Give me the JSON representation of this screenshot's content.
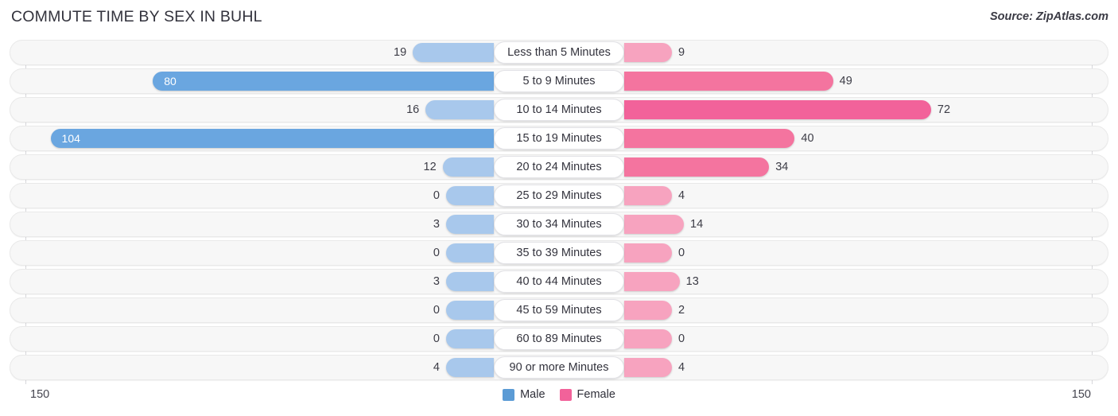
{
  "header": {
    "title": "COMMUTE TIME BY SEX IN BUHL",
    "source": "Source: ZipAtlas.com"
  },
  "axis": {
    "left_max_label": "150",
    "right_max_label": "150",
    "max": 150
  },
  "legend": {
    "items": [
      {
        "label": "Male",
        "color": "#5b9bd5"
      },
      {
        "label": "Female",
        "color": "#f2629a"
      }
    ]
  },
  "colors": {
    "male_light": "#a8c8ec",
    "male_strong": "#6aa6e0",
    "female_light": "#f7a3bf",
    "female_mid": "#f4749f",
    "female_strong": "#f2629a",
    "track": "#f7f7f7"
  },
  "chart_data": {
    "type": "bar",
    "title": "COMMUTE TIME BY SEX IN BUHL",
    "orientation": "horizontal-diverging",
    "xlabel": "",
    "ylabel": "",
    "xlim": [
      -150,
      150
    ],
    "grid": false,
    "legend_position": "bottom-center",
    "categories": [
      "Less than 5 Minutes",
      "5 to 9 Minutes",
      "10 to 14 Minutes",
      "15 to 19 Minutes",
      "20 to 24 Minutes",
      "25 to 29 Minutes",
      "30 to 34 Minutes",
      "35 to 39 Minutes",
      "40 to 44 Minutes",
      "45 to 59 Minutes",
      "60 to 89 Minutes",
      "90 or more Minutes"
    ],
    "series": [
      {
        "name": "Male",
        "values": [
          19,
          80,
          16,
          104,
          12,
          0,
          3,
          0,
          3,
          0,
          0,
          0
        ]
      },
      {
        "name": "Female",
        "values": [
          9,
          49,
          72,
          40,
          34,
          4,
          14,
          0,
          13,
          2,
          0,
          4
        ]
      }
    ]
  },
  "rows": [
    {
      "label": "Less than 5 Minutes",
      "male": "19",
      "female": "9"
    },
    {
      "label": "5 to 9 Minutes",
      "male": "80",
      "female": "49"
    },
    {
      "label": "10 to 14 Minutes",
      "male": "16",
      "female": "72"
    },
    {
      "label": "15 to 19 Minutes",
      "male": "104",
      "female": "40"
    },
    {
      "label": "20 to 24 Minutes",
      "male": "12",
      "female": "34"
    },
    {
      "label": "25 to 29 Minutes",
      "male": "0",
      "female": "4"
    },
    {
      "label": "30 to 34 Minutes",
      "male": "3",
      "female": "14"
    },
    {
      "label": "35 to 39 Minutes",
      "male": "0",
      "female": "0"
    },
    {
      "label": "40 to 44 Minutes",
      "male": "3",
      "female": "13"
    },
    {
      "label": "45 to 59 Minutes",
      "male": "0",
      "female": "2"
    },
    {
      "label": "60 to 89 Minutes",
      "male": "0",
      "female": "0"
    },
    {
      "label": "90 or more Minutes",
      "male": "4",
      "female": "4"
    }
  ]
}
